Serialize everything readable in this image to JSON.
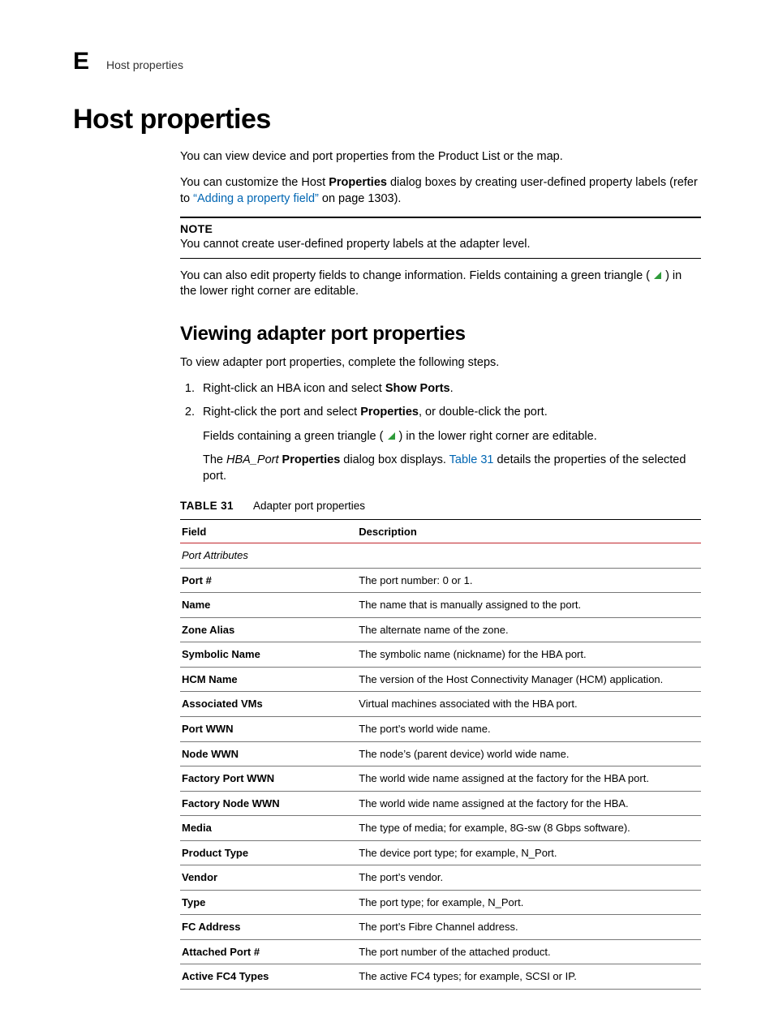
{
  "runningHead": {
    "letter": "E",
    "title": "Host properties"
  },
  "h1": "Host properties",
  "intro": {
    "p1": "You can view device and port properties from the Product List or the map.",
    "p2a": "You can customize the Host ",
    "p2b": "Properties",
    "p2c": " dialog boxes by creating user-defined property labels (refer to ",
    "p2link": "“Adding a property field”",
    "p2d": " on page 1303)."
  },
  "note": {
    "label": "NOTE",
    "text": "You cannot create user-defined property labels at the adapter level."
  },
  "p3a": "You can also edit property fields to change information. Fields containing a green triangle ( ",
  "p3b": " ) in the lower right corner are editable.",
  "h2": "Viewing adapter port properties",
  "p4": "To view adapter port properties, complete the following steps.",
  "steps": {
    "s1a": "Right-click an HBA icon and select ",
    "s1b": "Show Ports",
    "s1c": ".",
    "s2a": "Right-click the port and select ",
    "s2b": "Properties",
    "s2c": ", or double-click the port.",
    "s2p1a": "Fields containing a green triangle ( ",
    "s2p1b": " ) in the lower right corner are editable.",
    "s2p2a": "The ",
    "s2p2b": "HBA_Port",
    "s2p2c": " ",
    "s2p2d": "Properties",
    "s2p2e": " dialog box displays. ",
    "s2p2link": "Table 31",
    "s2p2f": " details the properties of the selected port."
  },
  "tableCaption": {
    "label": "TABLE 31",
    "title": "Adapter port properties"
  },
  "tableHead": {
    "c1": "Field",
    "c2": "Description"
  },
  "section1": "Port Attributes",
  "rows": [
    {
      "f": "Port #",
      "d": "The port number: 0 or 1."
    },
    {
      "f": "Name",
      "d": "The name that is manually assigned to the port."
    },
    {
      "f": "Zone Alias",
      "d": "The alternate name of the zone."
    },
    {
      "f": "Symbolic Name",
      "d": "The symbolic name (nickname) for the HBA port."
    },
    {
      "f": "HCM Name",
      "d": "The version of the Host Connectivity Manager (HCM) application."
    },
    {
      "f": "Associated VMs",
      "d": "Virtual machines associated with the HBA port."
    },
    {
      "f": "Port WWN",
      "d": "The port’s world wide name."
    },
    {
      "f": "Node WWN",
      "d": "The node’s (parent device) world wide name."
    },
    {
      "f": "Factory Port WWN",
      "d": "The world wide name assigned at the factory for the HBA port."
    },
    {
      "f": "Factory Node WWN",
      "d": "The world wide name assigned at the factory for the HBA."
    },
    {
      "f": "Media",
      "d": "The type of media; for example, 8G-sw (8 Gbps software)."
    },
    {
      "f": "Product Type",
      "d": "The device port type; for example, N_Port."
    },
    {
      "f": "Vendor",
      "d": "The port’s vendor."
    },
    {
      "f": "Type",
      "d": "The port type; for example, N_Port."
    },
    {
      "f": "FC Address",
      "d": "The port’s Fibre Channel address."
    },
    {
      "f": "Attached Port #",
      "d": "The port number of the attached product."
    },
    {
      "f": "Active FC4 Types",
      "d": "The active FC4 types; for example, SCSI or IP."
    }
  ]
}
